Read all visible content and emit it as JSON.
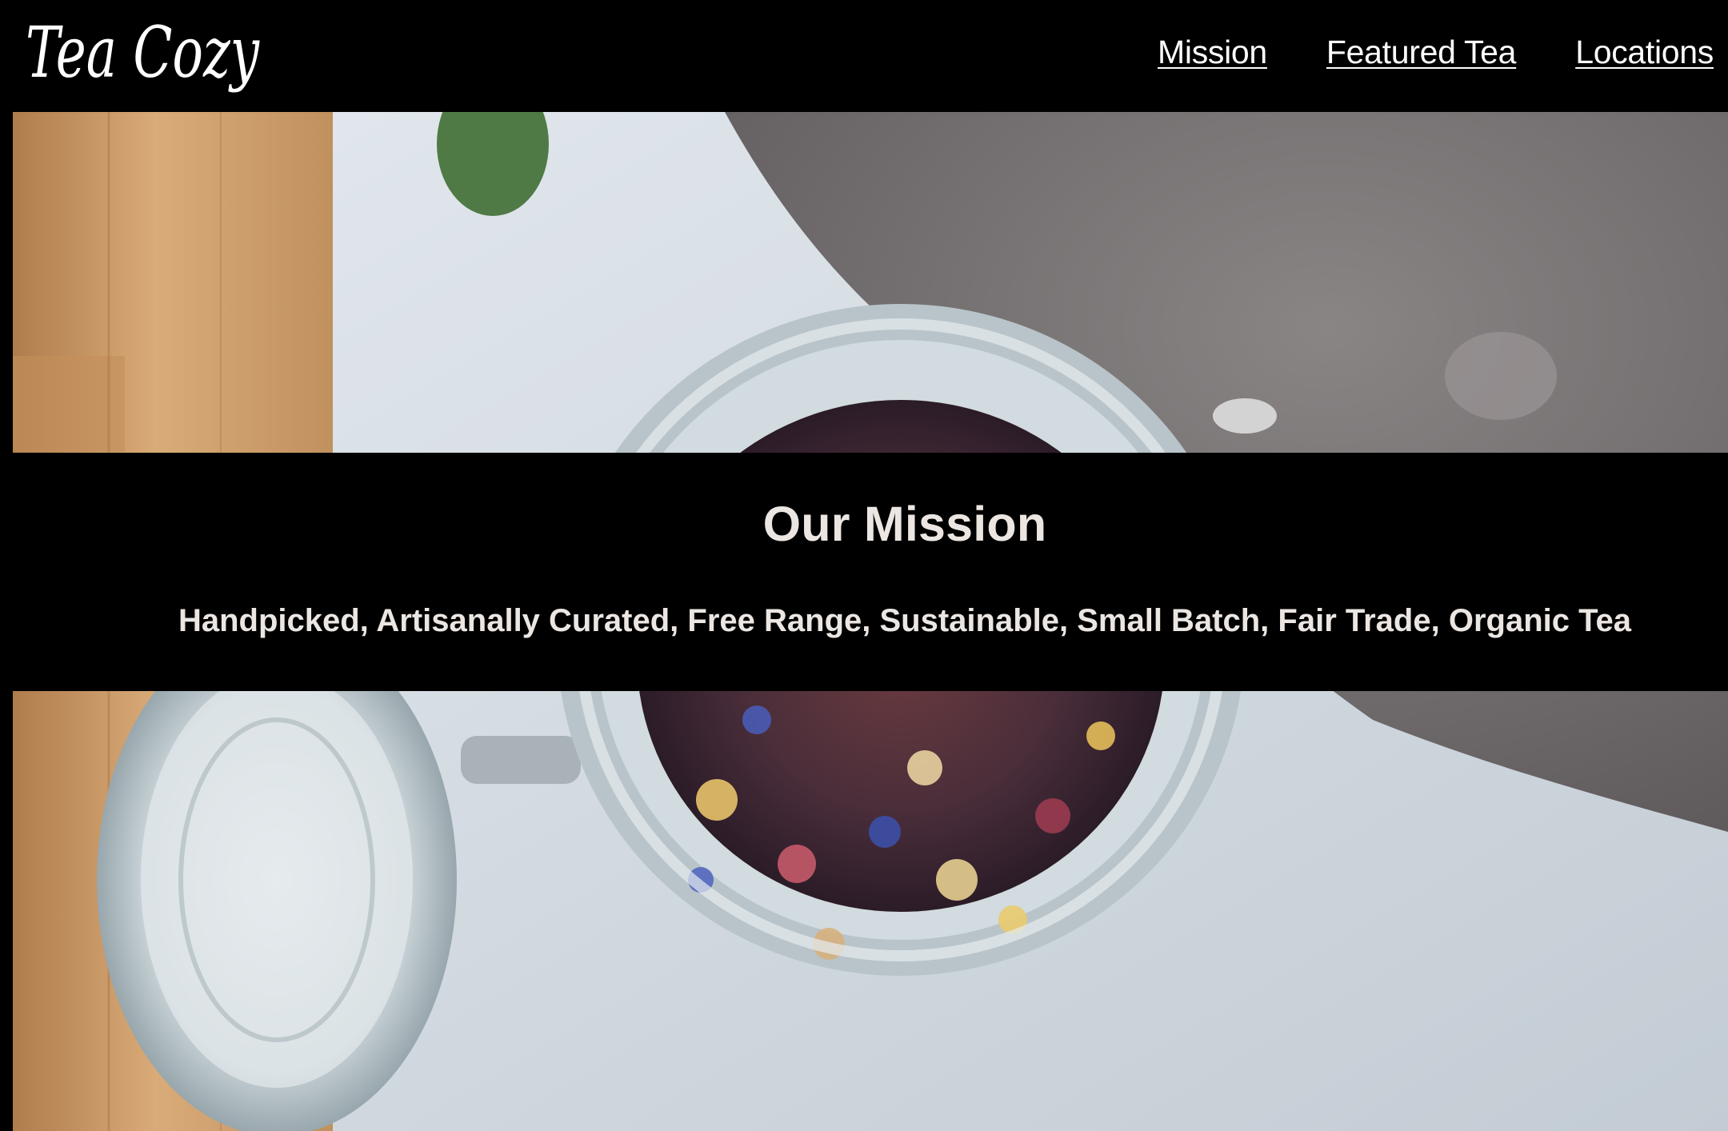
{
  "header": {
    "logo_text": "Tea Cozy",
    "nav": [
      {
        "label": "Mission"
      },
      {
        "label": "Featured Tea"
      },
      {
        "label": "Locations"
      }
    ]
  },
  "mission": {
    "title": "Our Mission",
    "tagline": "Handpicked, Artisanally Curated, Free Range, Sustainable, Small Batch, Fair Trade, Organic Tea"
  },
  "colors": {
    "header_bg": "#000000",
    "text_light": "#ece6e2",
    "nav_text": "#ffffff"
  }
}
